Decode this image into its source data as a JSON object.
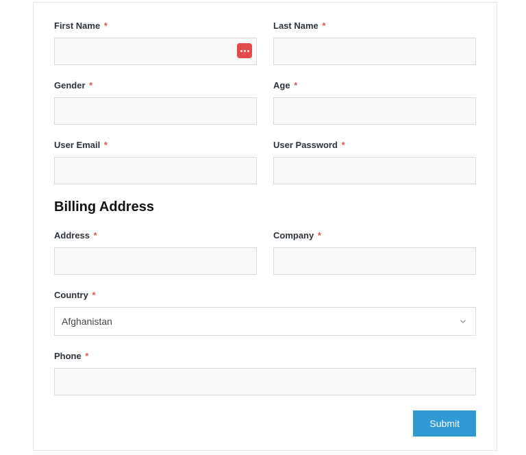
{
  "fields": {
    "first_name": {
      "label": "First Name",
      "value": ""
    },
    "last_name": {
      "label": "Last Name",
      "value": ""
    },
    "gender": {
      "label": "Gender",
      "value": ""
    },
    "age": {
      "label": "Age",
      "value": ""
    },
    "email": {
      "label": "User Email",
      "value": ""
    },
    "password": {
      "label": "User Password",
      "value": ""
    },
    "address": {
      "label": "Address",
      "value": ""
    },
    "company": {
      "label": "Company",
      "value": ""
    },
    "country": {
      "label": "Country",
      "value": "Afghanistan"
    },
    "phone": {
      "label": "Phone",
      "value": ""
    }
  },
  "required_marker": "*",
  "section_billing": "Billing Address",
  "submit_label": "Submit"
}
